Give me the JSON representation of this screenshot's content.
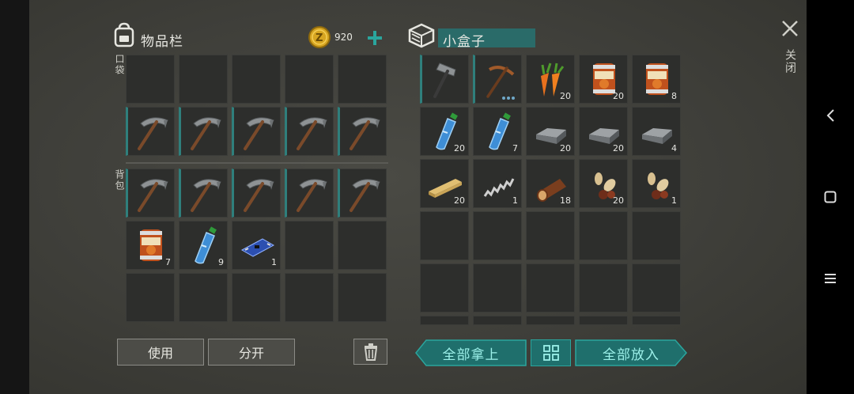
{
  "inventory": {
    "title": "物品栏",
    "coins": "920",
    "pocket_label": "口袋",
    "backpack_label": "背包",
    "pocket_slots": [
      {
        "item": "",
        "count": ""
      },
      {
        "item": "",
        "count": ""
      },
      {
        "item": "",
        "count": ""
      },
      {
        "item": "",
        "count": ""
      },
      {
        "item": "",
        "count": ""
      },
      {
        "item": "pickaxe",
        "count": ""
      },
      {
        "item": "pickaxe",
        "count": ""
      },
      {
        "item": "pickaxe",
        "count": ""
      },
      {
        "item": "pickaxe",
        "count": ""
      },
      {
        "item": "pickaxe",
        "count": ""
      }
    ],
    "backpack_slots": [
      {
        "item": "pickaxe",
        "count": ""
      },
      {
        "item": "pickaxe",
        "count": ""
      },
      {
        "item": "pickaxe",
        "count": ""
      },
      {
        "item": "pickaxe",
        "count": ""
      },
      {
        "item": "pickaxe",
        "count": ""
      },
      {
        "item": "food-can",
        "count": "7"
      },
      {
        "item": "water-bottle",
        "count": "9"
      },
      {
        "item": "circuit-board",
        "count": "1"
      },
      {
        "item": "",
        "count": ""
      },
      {
        "item": "",
        "count": ""
      },
      {
        "item": "",
        "count": ""
      },
      {
        "item": "",
        "count": ""
      },
      {
        "item": "",
        "count": ""
      },
      {
        "item": "",
        "count": ""
      },
      {
        "item": "",
        "count": ""
      }
    ],
    "use_label": "使用",
    "split_label": "分开"
  },
  "box": {
    "title": "小盒子",
    "slots": [
      {
        "item": "hammer",
        "count": ""
      },
      {
        "item": "pickaxe-iron",
        "count": ""
      },
      {
        "item": "carrot",
        "count": "20"
      },
      {
        "item": "food-can",
        "count": "20"
      },
      {
        "item": "food-can",
        "count": "8"
      },
      {
        "item": "water-bottle",
        "count": "20"
      },
      {
        "item": "water-bottle",
        "count": "7"
      },
      {
        "item": "iron-ingot",
        "count": "20"
      },
      {
        "item": "iron-ingot",
        "count": "20"
      },
      {
        "item": "iron-ingot",
        "count": "4"
      },
      {
        "item": "wood-plank",
        "count": "20"
      },
      {
        "item": "spring",
        "count": "1"
      },
      {
        "item": "log",
        "count": "18"
      },
      {
        "item": "seeds",
        "count": "20"
      },
      {
        "item": "seeds",
        "count": "1"
      }
    ],
    "take_all_label": "全部拿上",
    "put_all_label": "全部放入"
  },
  "close_label": "关闭",
  "colors": {
    "accent": "#1f6f6c",
    "accent_text": "#9cf0e9",
    "slot_bg": "#2d2e2c"
  }
}
